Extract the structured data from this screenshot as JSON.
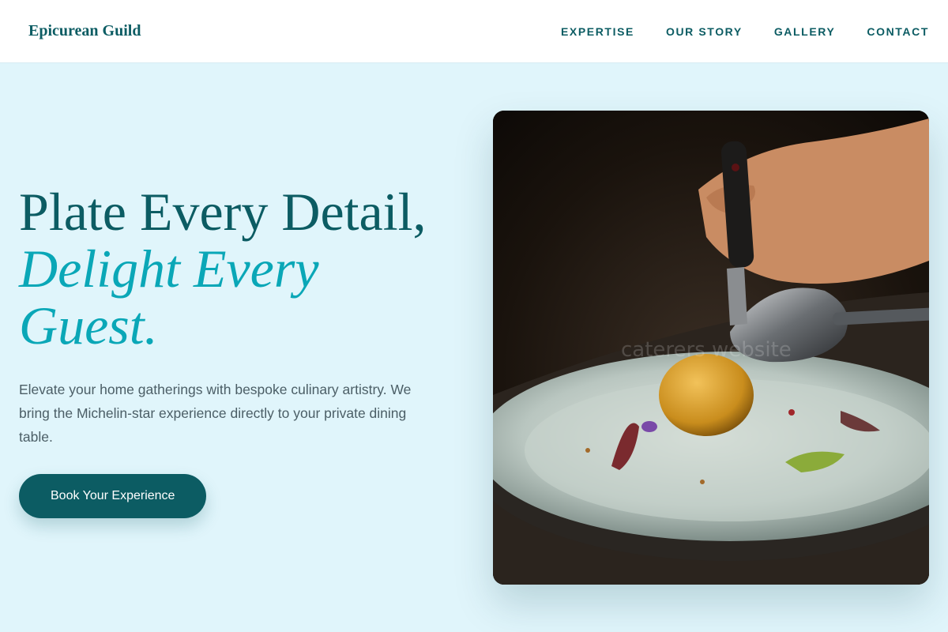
{
  "brand": {
    "name": "Epicurean Guild"
  },
  "nav": {
    "items": [
      {
        "label": "EXPERTISE"
      },
      {
        "label": "OUR STORY"
      },
      {
        "label": "GALLERY"
      },
      {
        "label": "CONTACT"
      }
    ]
  },
  "hero": {
    "headline_line1": "Plate Every Detail,",
    "headline_line2": "Delight Every Guest.",
    "lead": "Elevate your home gatherings with bespoke culinary artistry. We bring the Michelin-star experience directly to your private dining table.",
    "cta_label": "Book Your Experience",
    "photo_watermark": "caterers website"
  },
  "colors": {
    "accent_dark": "#0c5c63",
    "accent_light": "#0aa7b7",
    "page_bg": "#e0f5fb"
  }
}
